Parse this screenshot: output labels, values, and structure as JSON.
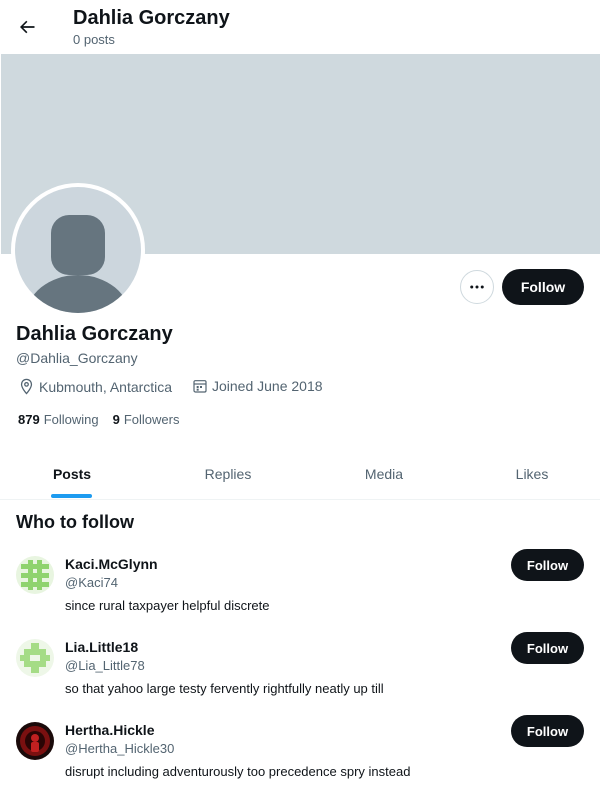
{
  "header": {
    "title": "Dahlia Gorczany",
    "subtitle": "0 posts"
  },
  "profile": {
    "name": "Dahlia Gorczany",
    "handle": "@Dahlia_Gorczany",
    "location": "Kubmouth, Antarctica",
    "joined": "Joined June 2018",
    "following_count": "879",
    "following_label": "Following",
    "followers_count": "9",
    "followers_label": "Followers",
    "follow_label": "Follow"
  },
  "tabs": [
    {
      "label": "Posts",
      "active": true
    },
    {
      "label": "Replies",
      "active": false
    },
    {
      "label": "Media",
      "active": false
    },
    {
      "label": "Likes",
      "active": false
    }
  ],
  "who_to_follow": {
    "title": "Who to follow",
    "users": [
      {
        "name": "Kaci.McGlynn",
        "handle": "@Kaci74",
        "bio": "since rural taxpayer helpful discrete",
        "follow_label": "Follow"
      },
      {
        "name": "Lia.Little18",
        "handle": "@Lia_Little78",
        "bio": "so that yahoo large testy fervently rightfully neatly up till",
        "follow_label": "Follow"
      },
      {
        "name": "Hertha.Hickle",
        "handle": "@Hertha_Hickle30",
        "bio": "disrupt including adventurously too precedence spry instead",
        "follow_label": "Follow"
      }
    ]
  },
  "colors": {
    "banner": "#cfd9de",
    "accent": "#1d9bf0",
    "button": "#0f1419",
    "secondary_text": "#536471"
  },
  "icons": {
    "back": "arrow-left-icon",
    "more": "more-horizontal-icon",
    "location": "location-pin-icon",
    "calendar": "calendar-icon"
  }
}
